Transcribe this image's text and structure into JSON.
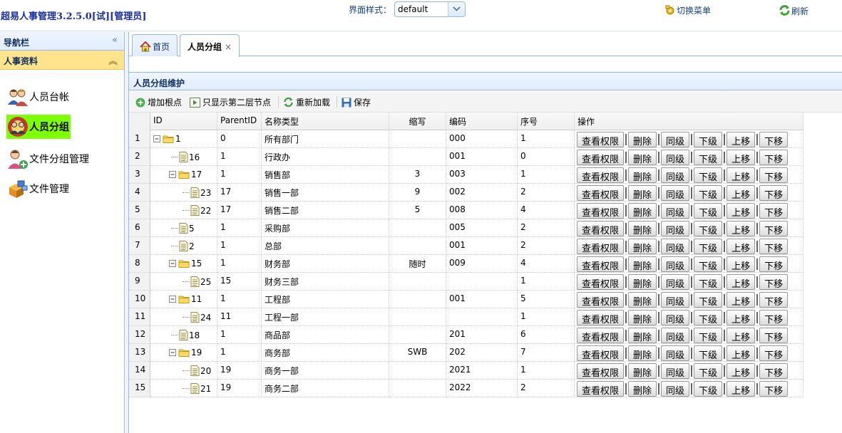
{
  "header": {
    "title": "超易人事管理3.2.5.0[试][管理员]",
    "theme_label": "界面样式：",
    "theme_value": "default",
    "switch_menu": "切换菜单",
    "refresh": "刷新"
  },
  "sidebar": {
    "title": "导航栏",
    "section": "人事资料",
    "items": [
      {
        "label": "人员台帐",
        "icon": "people-icon"
      },
      {
        "label": "人员分组",
        "icon": "group-icon"
      },
      {
        "label": "文件分组管理",
        "icon": "user-file-icon"
      },
      {
        "label": "文件管理",
        "icon": "boxes-icon"
      }
    ]
  },
  "tabs": [
    {
      "label": "首页",
      "icon": "home-icon"
    },
    {
      "label": "人员分组",
      "close": "×"
    }
  ],
  "panel": {
    "title": "人员分组维护",
    "toolbar": {
      "add_root": "增加根点",
      "show_level2": "只显示第二层节点",
      "reload": "重新加载",
      "save": "保存"
    }
  },
  "grid": {
    "columns": [
      "ID",
      "ParentID",
      "名称类型",
      "缩写",
      "编码",
      "序号",
      "操作"
    ],
    "actions": [
      "查看权限",
      "删除",
      "同级",
      "下级",
      "上移",
      "下移"
    ],
    "rows": [
      {
        "rn": "1",
        "id": "1",
        "pid": "0",
        "name": "所有部门",
        "abbr": "",
        "code": "000",
        "order": "1"
      },
      {
        "rn": "2",
        "id": "16",
        "pid": "1",
        "name": "行政办",
        "abbr": "",
        "code": "001",
        "order": "0"
      },
      {
        "rn": "3",
        "id": "17",
        "pid": "1",
        "name": "销售部",
        "abbr": "3",
        "code": "003",
        "order": "1"
      },
      {
        "rn": "4",
        "id": "23",
        "pid": "17",
        "name": "销售一部",
        "abbr": "9",
        "code": "002",
        "order": "2"
      },
      {
        "rn": "5",
        "id": "22",
        "pid": "17",
        "name": "销售二部",
        "abbr": "5",
        "code": "008",
        "order": "4"
      },
      {
        "rn": "6",
        "id": "5",
        "pid": "1",
        "name": "采购部",
        "abbr": "",
        "code": "005",
        "order": "2"
      },
      {
        "rn": "7",
        "id": "2",
        "pid": "1",
        "name": "总部",
        "abbr": "",
        "code": "001",
        "order": "2"
      },
      {
        "rn": "8",
        "id": "15",
        "pid": "1",
        "name": "财务部",
        "abbr": "随时",
        "code": "009",
        "order": "4"
      },
      {
        "rn": "9",
        "id": "25",
        "pid": "15",
        "name": "财务三部",
        "abbr": "",
        "code": "",
        "order": "1"
      },
      {
        "rn": "10",
        "id": "11",
        "pid": "1",
        "name": "工程部",
        "abbr": "",
        "code": "001",
        "order": "5"
      },
      {
        "rn": "11",
        "id": "24",
        "pid": "11",
        "name": "工程一部",
        "abbr": "",
        "code": "",
        "order": "1"
      },
      {
        "rn": "12",
        "id": "18",
        "pid": "1",
        "name": "商品部",
        "abbr": "",
        "code": "201",
        "order": "6"
      },
      {
        "rn": "13",
        "id": "19",
        "pid": "1",
        "name": "商务部",
        "abbr": "SWB",
        "code": "202",
        "order": "7"
      },
      {
        "rn": "14",
        "id": "20",
        "pid": "19",
        "name": "商务一部",
        "abbr": "",
        "code": "2021",
        "order": "1"
      },
      {
        "rn": "15",
        "id": "21",
        "pid": "19",
        "name": "商务二部",
        "abbr": "",
        "code": "2022",
        "order": "2"
      }
    ]
  },
  "colors": {
    "title_blue": "#1a2fa0",
    "header_gradient": "#e0ecff",
    "accordion_yellow": "#ffe48d",
    "active_item_green": "#7dff06",
    "border_blue": "#95b8e7"
  }
}
